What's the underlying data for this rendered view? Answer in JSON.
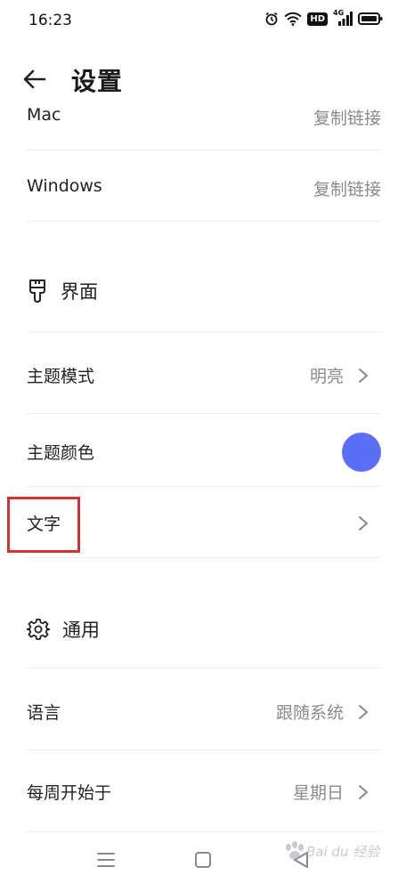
{
  "status": {
    "time": "16:23",
    "hd_badge": "HD",
    "network": "4G"
  },
  "header": {
    "back_icon": "arrow-left-icon",
    "title": "设置"
  },
  "rows": {
    "mac": {
      "label": "Mac",
      "value": "复制链接"
    },
    "windows": {
      "label": "Windows",
      "value": "复制链接"
    }
  },
  "sections": {
    "interface": {
      "icon": "brush-icon",
      "title": "界面"
    },
    "general": {
      "icon": "gear-icon",
      "title": "通用"
    }
  },
  "interface_rows": {
    "theme_mode": {
      "label": "主题模式",
      "value": "明亮"
    },
    "theme_color": {
      "label": "主题颜色",
      "color": "#5b6ef5"
    },
    "text": {
      "label": "文字"
    }
  },
  "general_rows": {
    "language": {
      "label": "语言",
      "value": "跟随系统"
    },
    "week_start": {
      "label": "每周开始于",
      "value": "星期日"
    }
  },
  "watermark": {
    "text": "Bai du 经验"
  },
  "colors": {
    "highlight": "#d23232",
    "accent": "#5b6ef5"
  }
}
